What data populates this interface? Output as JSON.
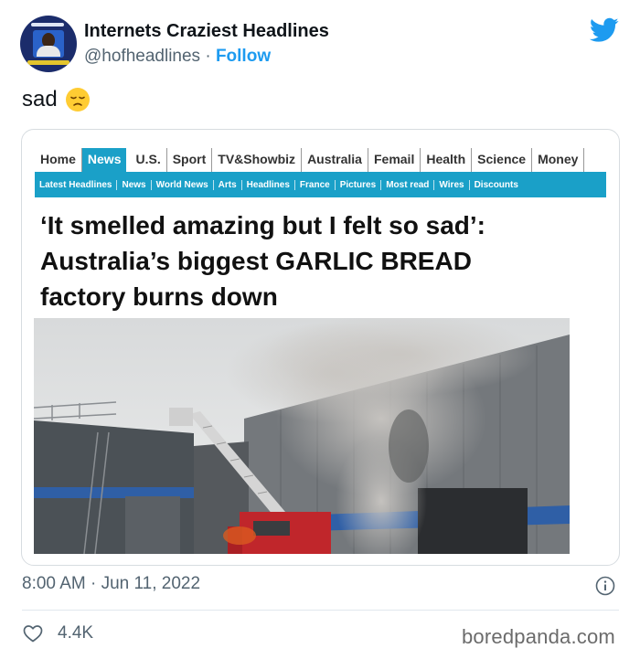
{
  "author": {
    "name": "Internets Craziest Headlines",
    "handle": "@hofheadlines",
    "separator": "·",
    "follow_label": "Follow"
  },
  "tweet": {
    "text": "sad",
    "emoji_icon": "disappointed-face-emoji",
    "timestamp": "8:00 AM · Jun 11, 2022",
    "likes": "4.4K"
  },
  "article": {
    "nav_primary": [
      "Home",
      "News",
      "U.S.",
      "Sport",
      "TV&Showbiz",
      "Australia",
      "Femail",
      "Health",
      "Science",
      "Money"
    ],
    "nav_primary_active": "News",
    "nav_secondary": [
      "Latest Headlines",
      "News",
      "World News",
      "Arts",
      "Headlines",
      "France",
      "Pictures",
      "Most read",
      "Wires",
      "Discounts"
    ],
    "headline_lines": [
      "‘It smelled amazing but I felt so sad’:",
      "Australia’s biggest GARLIC BREAD",
      "factory burns down"
    ]
  },
  "watermark": "boredpanda.com",
  "colors": {
    "twitter_blue": "#1d9bf0",
    "nav_blue": "#1aa0c8",
    "secondary_text": "#536471"
  },
  "icons": {
    "platform": "twitter-bird-icon",
    "info": "info-icon",
    "like": "heart-icon"
  }
}
